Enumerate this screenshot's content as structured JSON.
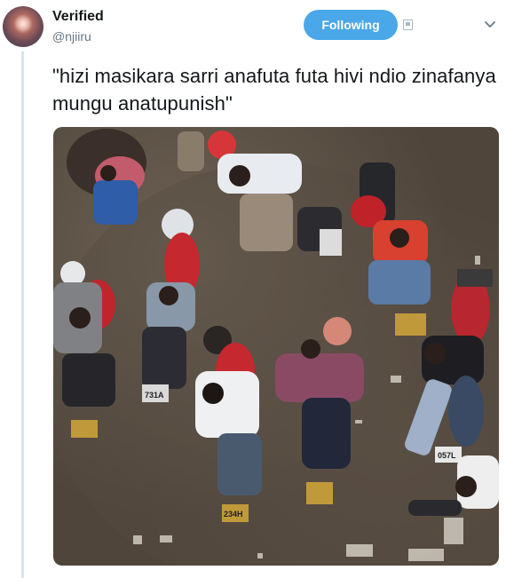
{
  "tweet": {
    "display_name": "Verified",
    "handle": "@njiiru",
    "follow_label": "Following",
    "text": "\"hizi masikara sarri anafuta futa hivi ndio zinafanya mungu anatupunish\""
  },
  "photo": {
    "plates": [
      "731A",
      "234H",
      "057L"
    ]
  },
  "colors": {
    "follow_button": "#4aa7e8",
    "thread_line": "#d7e4ee",
    "handle_text": "#657786"
  },
  "icons": [
    "notifications-icon",
    "chevron-down-icon"
  ]
}
